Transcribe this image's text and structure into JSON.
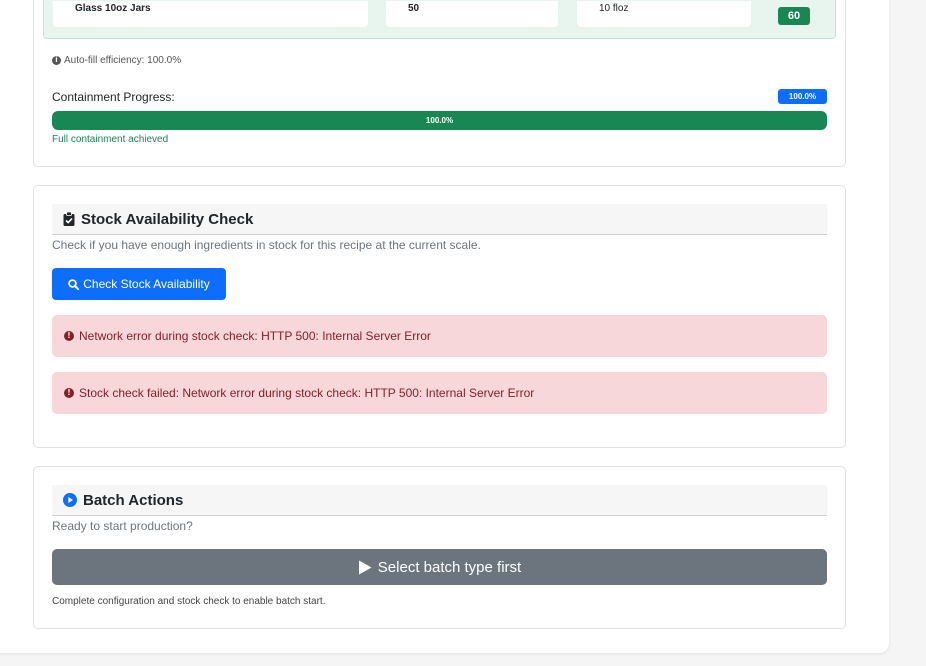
{
  "container": {
    "name": "Glass 10oz Jars",
    "quantity": "50",
    "capacity": "10 floz",
    "count_badge": "60"
  },
  "auto_fill": {
    "text": "Auto-fill efficiency: 100.0%"
  },
  "containment": {
    "label": "Containment Progress:",
    "badge": "100.0%",
    "bar_text": "100.0%",
    "progress_percent": 100,
    "status": "Full containment achieved"
  },
  "stock": {
    "title": "Stock Availability Check",
    "description": "Check if you have enough ingredients in stock for this recipe at the current scale.",
    "button_label": "Check Stock Availability",
    "alerts": [
      "Network error during stock check: HTTP 500: Internal Server Error",
      "Stock check failed: Network error during stock check: HTTP 500: Internal Server Error"
    ]
  },
  "batch": {
    "title": "Batch Actions",
    "description": "Ready to start production?",
    "button_label": "Select batch type first",
    "hint": "Complete configuration and stock check to enable batch start."
  },
  "colors": {
    "primary": "#0d6efd",
    "success": "#198754",
    "danger_bg": "#f8d7da",
    "danger_text": "#842029",
    "disabled": "#6c757d"
  },
  "icons": {
    "info": "info-circle-icon",
    "clipboard": "clipboard-check-icon",
    "search": "search-icon",
    "error": "exclamation-circle-icon",
    "play_circle": "play-circle-icon",
    "play": "play-icon"
  }
}
